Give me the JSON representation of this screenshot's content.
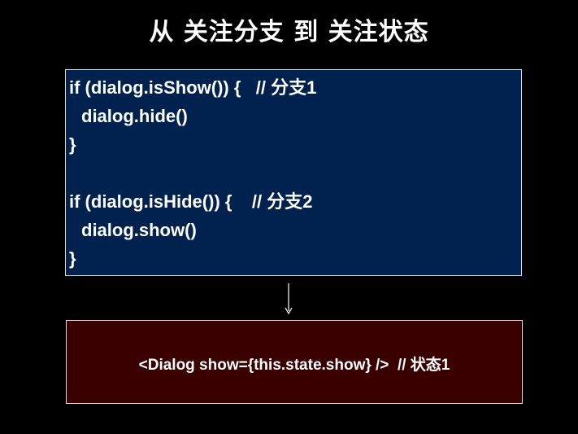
{
  "title": "从 关注分支 到 关注状态",
  "code_block": {
    "lines": [
      "if (dialog.isShow()) {   // 分支1",
      "dialog.hide()",
      "}",
      "",
      "if (dialog.isHide()) {    // 分支2",
      "dialog.show()",
      "}"
    ]
  },
  "arrow_icon": "down-arrow-icon",
  "result_block": {
    "text": "<Dialog show={this.state.show} />  // 状态1"
  },
  "colors": {
    "background": "#000000",
    "code_box": "#01214f",
    "result_box": "#3a0000",
    "text": "#ffffff"
  }
}
